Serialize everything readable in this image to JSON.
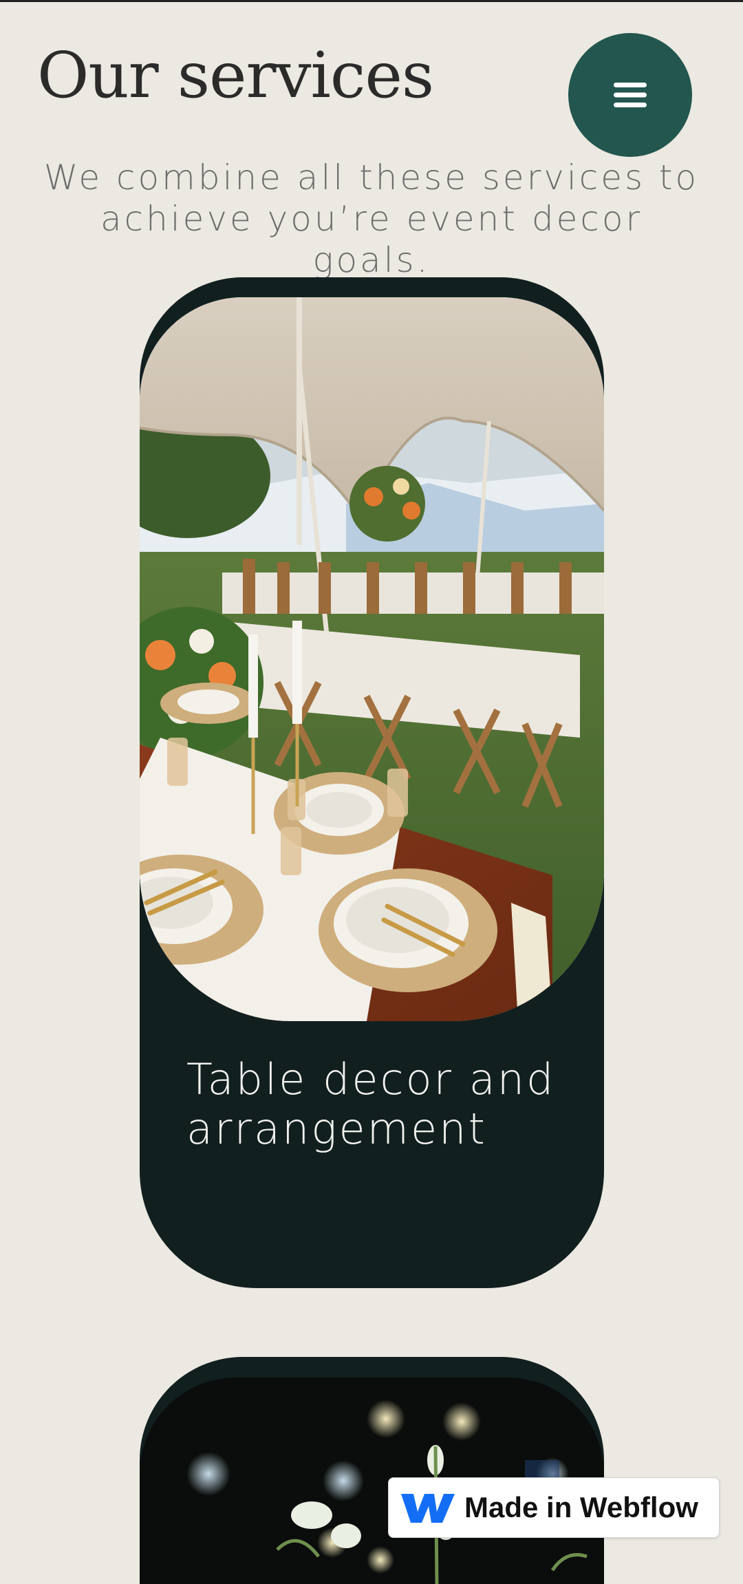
{
  "header": {
    "title": "Our services",
    "menu_icon": "hamburger-icon"
  },
  "intro": {
    "subtitle": "We combine all these services to achieve you’re event decor goals."
  },
  "services": [
    {
      "title": "Table decor and arrangement",
      "image": "outdoor tent banquet with wooden tables, floral centerpieces and gold cutlery"
    },
    {
      "title": "",
      "image": "night event with white flowers and bokeh lights"
    }
  ],
  "badge": {
    "label": "Made in Webflow",
    "icon": "webflow-logo-icon"
  },
  "colors": {
    "background": "#ebe9e1",
    "accent": "#22564f",
    "card": "#111f1f"
  }
}
